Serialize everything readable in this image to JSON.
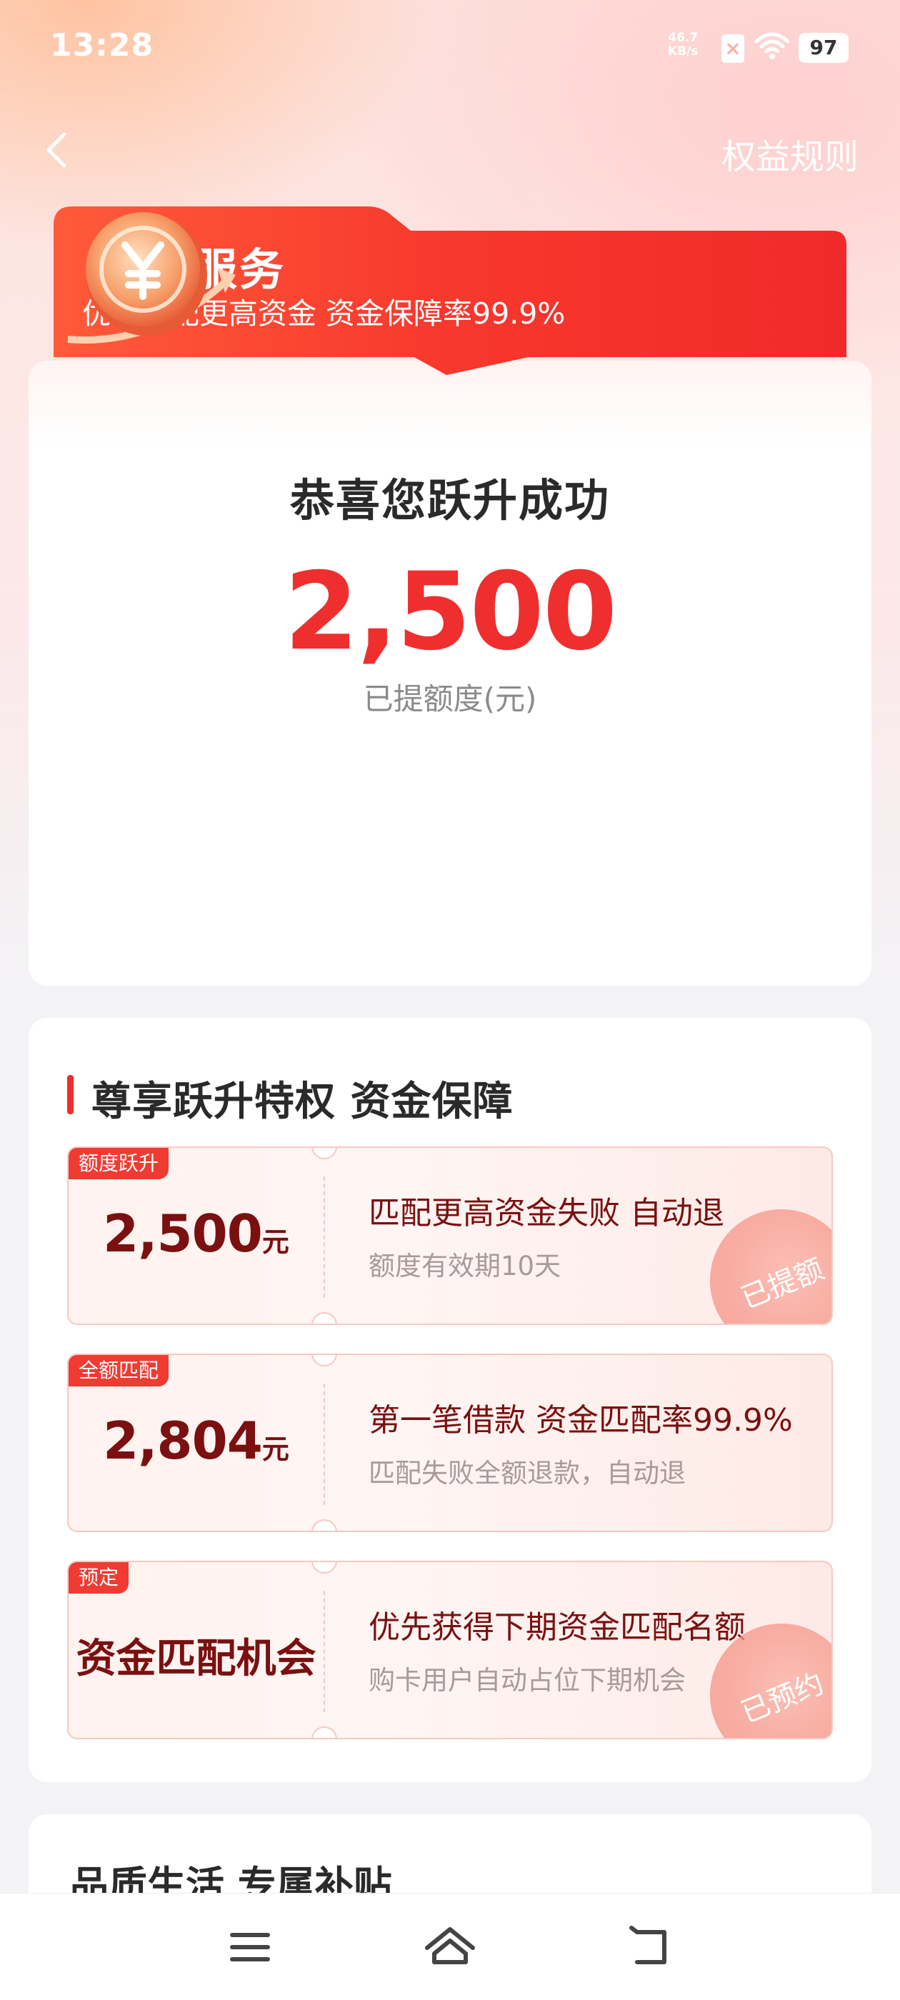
{
  "status_bar": {
    "time": "13:28",
    "net_speed_value": "46.7",
    "net_speed_unit": "KB/s",
    "battery": "97"
  },
  "header": {
    "rules_label": "权益规则"
  },
  "banner": {
    "title": "跃升服务",
    "subtitle": "优先匹配更高资金 资金保障率99.9%"
  },
  "success": {
    "title": "恭喜您跃升成功",
    "amount": "2,500",
    "label": "已提额度(元)"
  },
  "privileges": {
    "heading": "尊享跃升特权 资金保障",
    "items": [
      {
        "tag": "额度跃升",
        "amount": "2,500",
        "unit": "元",
        "main": "匹配更高资金失败 自动退",
        "sub": "额度有效期10天",
        "stamp": "已提额"
      },
      {
        "tag": "全额匹配",
        "amount": "2,804",
        "unit": "元",
        "main": "第一笔借款 资金匹配率99.9%",
        "sub": "匹配失败全额退款，自动退"
      },
      {
        "tag": "预定",
        "big_text": "资金匹配机会",
        "main": "优先获得下期资金匹配名额",
        "sub": "购卡用户自动占位下期机会",
        "stamp": "已预约"
      }
    ]
  },
  "life": {
    "heading": "品质生活 专属补贴"
  },
  "colors": {
    "accent_red": "#ef2e2e",
    "dark_red": "#7a1010"
  }
}
